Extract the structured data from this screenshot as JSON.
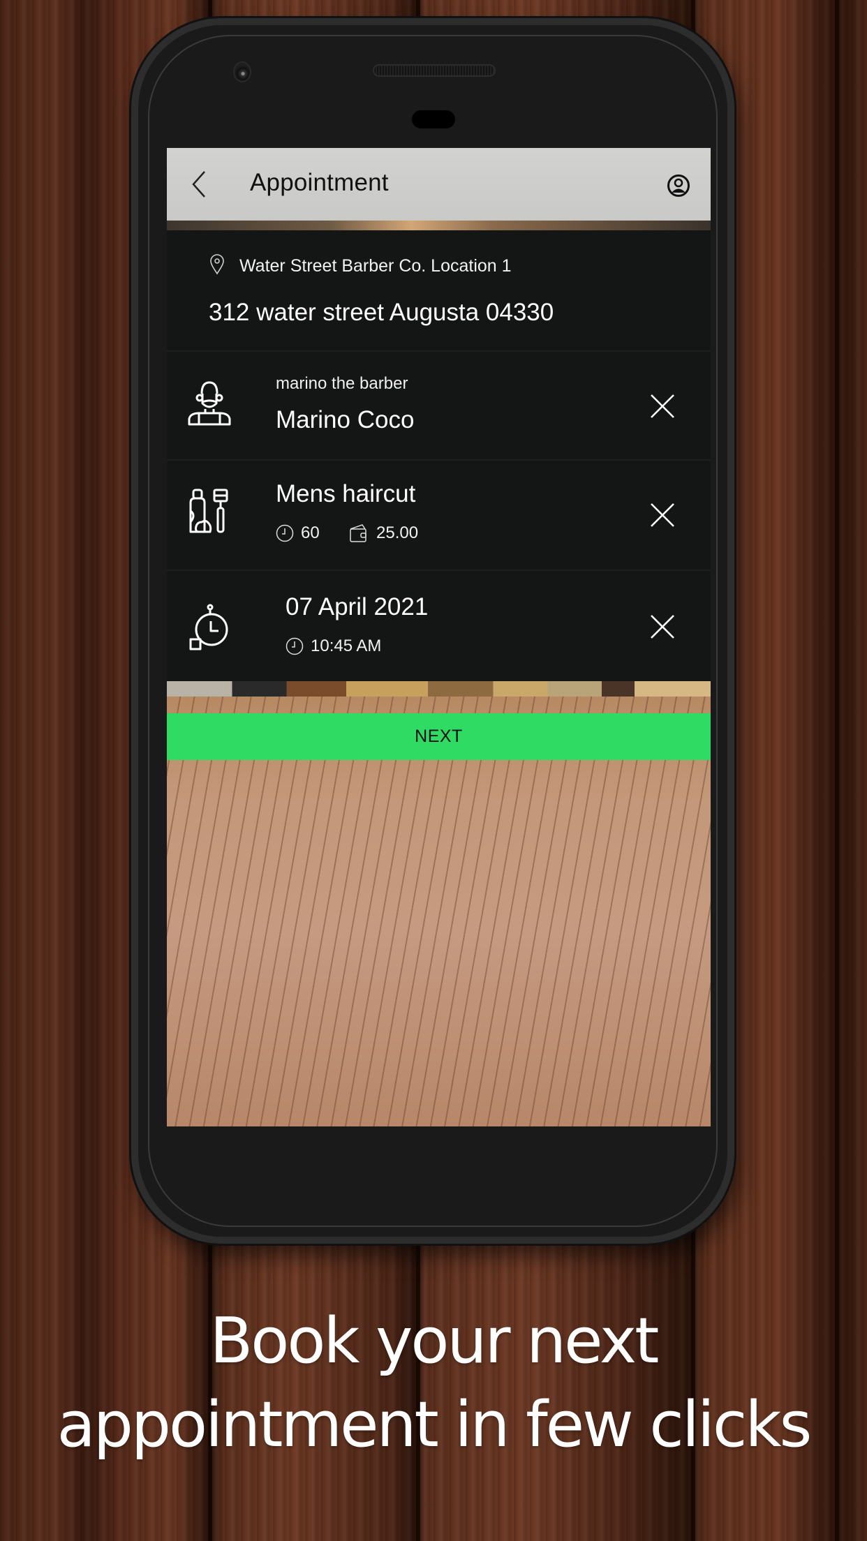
{
  "app": {
    "title": "Appointment",
    "icons": {
      "back": "chevron-left-icon",
      "profile": "user-circle-icon"
    }
  },
  "location": {
    "icon": "map-pin-icon",
    "name": "Water Street Barber Co. Location 1",
    "address": "312 water street Augusta 04330"
  },
  "barber": {
    "icon": "barber-icon",
    "nickname": "marino the barber",
    "name": "Marino Coco",
    "remove_icon": "close-icon"
  },
  "service": {
    "icon": "grooming-products-icon",
    "name": "Mens haircut",
    "duration_icon": "clock-icon",
    "duration": "60",
    "price_icon": "wallet-icon",
    "price": "25.00",
    "remove_icon": "close-icon"
  },
  "schedule": {
    "icon": "stopwatch-icon",
    "date": "07 April 2021",
    "time_icon": "clock-icon",
    "time": "10:45 AM",
    "remove_icon": "close-icon"
  },
  "actions": {
    "next_label": "NEXT"
  },
  "colors": {
    "accent": "#2fdb63",
    "appbar": "#cbcbc9",
    "card": "#141515"
  },
  "marketing": {
    "caption_line1": "Book your next",
    "caption_line2": "appointment in few clicks"
  }
}
